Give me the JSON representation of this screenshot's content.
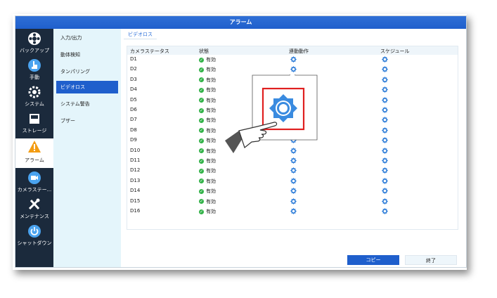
{
  "window": {
    "title": "アラーム"
  },
  "nav": {
    "items": [
      {
        "label": "バックアップ",
        "icon": "film-reel-icon"
      },
      {
        "label": "手動",
        "icon": "hand-pointer-icon"
      },
      {
        "label": "システム",
        "icon": "gear-icon"
      },
      {
        "label": "ストレージ",
        "icon": "storage-icon"
      },
      {
        "label": "アラーム",
        "icon": "warning-icon",
        "active": true
      },
      {
        "label": "カメラステー...",
        "icon": "camera-icon"
      },
      {
        "label": "メンテナンス",
        "icon": "tools-icon"
      },
      {
        "label": "シャットダウン",
        "icon": "power-icon"
      }
    ]
  },
  "submenu": {
    "items": [
      {
        "label": "入力/出力"
      },
      {
        "label": "動体検知"
      },
      {
        "label": "タンパリング"
      },
      {
        "label": "ビデオロス",
        "active": true
      },
      {
        "label": "システム警告"
      },
      {
        "label": "ブザー"
      }
    ]
  },
  "tab": {
    "label": "ビデオロス"
  },
  "table": {
    "headers": [
      "カメラステータス",
      "状態",
      "連動動作",
      "スケジュール"
    ],
    "rows": [
      {
        "camera": "D1",
        "status": "有効"
      },
      {
        "camera": "D2",
        "status": "有効"
      },
      {
        "camera": "D3",
        "status": "有効"
      },
      {
        "camera": "D4",
        "status": "有効"
      },
      {
        "camera": "D5",
        "status": "有効"
      },
      {
        "camera": "D6",
        "status": "有効"
      },
      {
        "camera": "D7",
        "status": "有効"
      },
      {
        "camera": "D8",
        "status": "有効"
      },
      {
        "camera": "D9",
        "status": "有効"
      },
      {
        "camera": "D10",
        "status": "有効"
      },
      {
        "camera": "D11",
        "status": "有効"
      },
      {
        "camera": "D12",
        "status": "有効"
      },
      {
        "camera": "D13",
        "status": "有効"
      },
      {
        "camera": "D14",
        "status": "有効"
      },
      {
        "camera": "D15",
        "status": "有効"
      },
      {
        "camera": "D16",
        "status": "有効"
      }
    ]
  },
  "buttons": {
    "copy": "コピー",
    "exit": "終了"
  },
  "colors": {
    "accent": "#1f5fcc",
    "nav_bg": "#1b2a3c",
    "submenu_bg": "#e4f5fb",
    "ok_green": "#33b249",
    "highlight_red": "#e02020"
  }
}
